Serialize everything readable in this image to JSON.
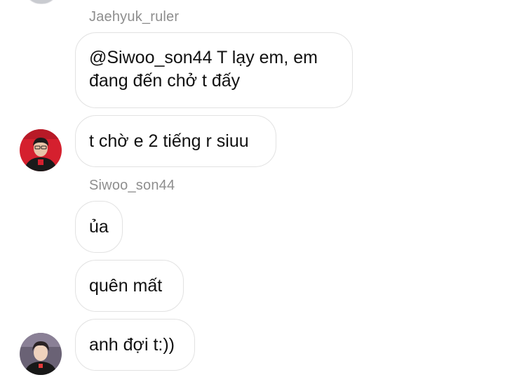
{
  "messages": [
    {
      "sender": "Jaehyuk_ruler",
      "text": "@Siwoo_son44 T lạy em, em đang đến chở t đấy"
    },
    {
      "text": "t chờ e 2 tiếng r siuu"
    },
    {
      "sender": "Siwoo_son44",
      "text": "ủa"
    },
    {
      "text": "quên mất"
    },
    {
      "text": "anh đợi t:))"
    }
  ],
  "colors": {
    "bubble_border": "#e2e2e2",
    "sender_text": "#8e8e8e",
    "message_text": "#111111",
    "avatar1_bg": "#d5202e",
    "avatar2_bg": "#6a6275"
  },
  "icons": [
    "avatar-jaehyuk",
    "avatar-siwoo"
  ]
}
